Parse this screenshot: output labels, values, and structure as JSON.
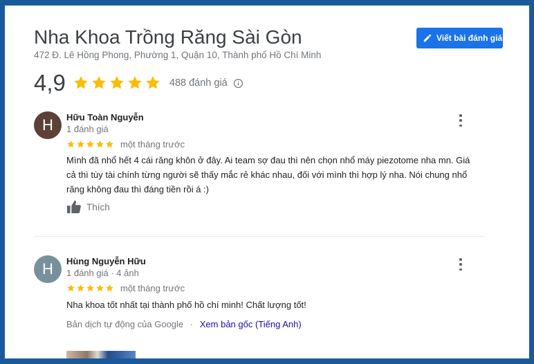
{
  "place": {
    "title": "Nha Khoa Trồng Răng Sài Gòn",
    "address": "472 Đ. Lê Hồng Phong, Phường 1, Quận 10, Thành phố Hồ Chí Minh",
    "rating": "4,9",
    "stars": 5,
    "review_count": "488 đánh giá"
  },
  "actions": {
    "write_review": "Viết bài đánh giá"
  },
  "colors": {
    "accent": "#1a73e8",
    "star": "#fbbc04",
    "frame": "#1a5a9a"
  },
  "reviews": [
    {
      "initial": "H",
      "avatar_color": "#5d4037",
      "name": "Hữu Toàn Nguyễn",
      "meta": "1 đánh giá",
      "stars": 5,
      "date": "một tháng trước",
      "text": "Mình đã nhổ hết 4 cái răng khôn ở đây. Ai team sợ đau thì nên chọn nhổ máy piezotome nha mn. Giá cả thì tùy tài chính từng người sẽ thấy mắc rẻ khác nhau, đối với mình thì hợp lý nha. Nói chung nhổ răng không đau thì đáng tiền rồi á :)",
      "like_label": "Thích"
    },
    {
      "initial": "H",
      "avatar_color": "#78909c",
      "name": "Hùng Nguyễn Hữu",
      "meta": "1 đánh giá · 4 ảnh",
      "stars": 5,
      "date": "một tháng trước",
      "text": "Nha khoa tốt nhất tại thành phố hồ chí minh! Chất lượng tốt!",
      "translation_note": "Bản dịch tự động của Google",
      "translation_sep": "·",
      "translation_link": "Xem bản gốc (Tiếng Anh)"
    }
  ]
}
